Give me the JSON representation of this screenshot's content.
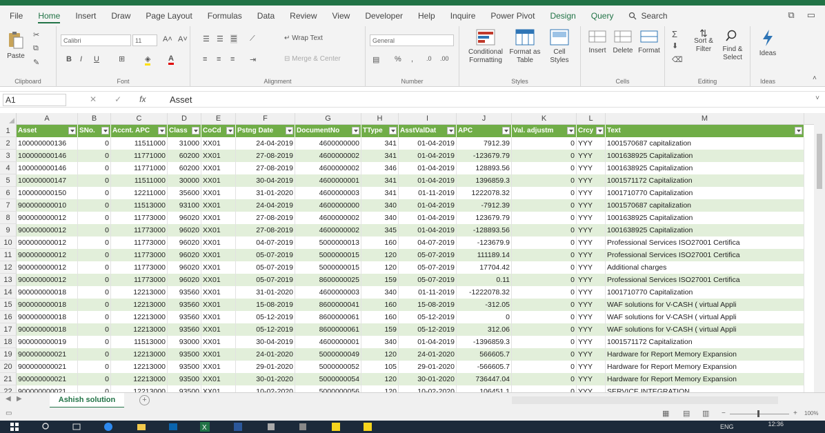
{
  "ribbon": {
    "tabs": [
      "File",
      "Home",
      "Insert",
      "Draw",
      "Page Layout",
      "Formulas",
      "Data",
      "Review",
      "View",
      "Developer",
      "Help",
      "Inquire",
      "Power Pivot",
      "Design",
      "Query"
    ],
    "search_label": "Search",
    "clipboard": {
      "paste": "Paste",
      "label": "Clipboard"
    },
    "font": {
      "name": "Calibri",
      "size": "11",
      "label": "Font"
    },
    "alignment": {
      "wrap": "Wrap Text",
      "merge": "Merge & Center",
      "label": "Alignment"
    },
    "number": {
      "format": "General",
      "label": "Number"
    },
    "styles": {
      "cond1": "Conditional",
      "cond2": "Formatting",
      "fmt1": "Format as",
      "fmt2": "Table",
      "cell1": "Cell",
      "cell2": "Styles",
      "label": "Styles"
    },
    "cells": {
      "insert": "Insert",
      "delete": "Delete",
      "format": "Format",
      "label": "Cells"
    },
    "editing": {
      "sort1": "Sort &",
      "sort2": "Filter",
      "find1": "Find &",
      "find2": "Select",
      "label": "Editing"
    },
    "ideas": {
      "btn": "Ideas",
      "label": "Ideas"
    }
  },
  "formula_bar": {
    "name_box": "A1",
    "formula": "Asset"
  },
  "columns": [
    "A",
    "B",
    "C",
    "D",
    "E",
    "F",
    "G",
    "H",
    "I",
    "J",
    "K",
    "L",
    "M"
  ],
  "header": [
    "Asset",
    "SNo.",
    "Accnt. APC",
    "Class",
    "CoCd",
    "Pstng Date",
    "DocumentNo",
    "TType",
    "AsstValDat",
    "APC",
    "Val. adjustm",
    "Crcy",
    "Text"
  ],
  "rows": [
    [
      "2",
      "100000000136",
      "0",
      "11511000",
      "31000",
      "XX01",
      "24-04-2019",
      "4600000000",
      "341",
      "01-04-2019",
      "7912.39",
      "0",
      "YYY",
      "1001570687 capitalization"
    ],
    [
      "3",
      "100000000146",
      "0",
      "11771000",
      "60200",
      "XX01",
      "27-08-2019",
      "4600000002",
      "341",
      "01-04-2019",
      "-123679.79",
      "0",
      "YYY",
      "1001638925 Capitalization"
    ],
    [
      "4",
      "100000000146",
      "0",
      "11771000",
      "60200",
      "XX01",
      "27-08-2019",
      "4600000002",
      "346",
      "01-04-2019",
      "128893.56",
      "0",
      "YYY",
      "1001638925 Capitalization"
    ],
    [
      "5",
      "100000000147",
      "0",
      "11511000",
      "30000",
      "XX01",
      "30-04-2019",
      "4600000001",
      "341",
      "01-04-2019",
      "1396859.3",
      "0",
      "YYY",
      "1001571172 Capitalization"
    ],
    [
      "6",
      "100000000150",
      "0",
      "12211000",
      "35600",
      "XX01",
      "31-01-2020",
      "4600000003",
      "341",
      "01-11-2019",
      "1222078.32",
      "0",
      "YYY",
      "1001710770 Capitalization"
    ],
    [
      "7",
      "900000000010",
      "0",
      "11513000",
      "93100",
      "XX01",
      "24-04-2019",
      "4600000000",
      "340",
      "01-04-2019",
      "-7912.39",
      "0",
      "YYY",
      "1001570687 capitalization"
    ],
    [
      "8",
      "900000000012",
      "0",
      "11773000",
      "96020",
      "XX01",
      "27-08-2019",
      "4600000002",
      "340",
      "01-04-2019",
      "123679.79",
      "0",
      "YYY",
      "1001638925 Capitalization"
    ],
    [
      "9",
      "900000000012",
      "0",
      "11773000",
      "96020",
      "XX01",
      "27-08-2019",
      "4600000002",
      "345",
      "01-04-2019",
      "-128893.56",
      "0",
      "YYY",
      "1001638925 Capitalization"
    ],
    [
      "10",
      "900000000012",
      "0",
      "11773000",
      "96020",
      "XX01",
      "04-07-2019",
      "5000000013",
      "160",
      "04-07-2019",
      "-123679.9",
      "0",
      "YYY",
      "Professional Services ISO27001 Certifica"
    ],
    [
      "11",
      "900000000012",
      "0",
      "11773000",
      "96020",
      "XX01",
      "05-07-2019",
      "5000000015",
      "120",
      "05-07-2019",
      "111189.14",
      "0",
      "YYY",
      "Professional Services ISO27001 Certifica"
    ],
    [
      "12",
      "900000000012",
      "0",
      "11773000",
      "96020",
      "XX01",
      "05-07-2019",
      "5000000015",
      "120",
      "05-07-2019",
      "17704.42",
      "0",
      "YYY",
      "Additional charges"
    ],
    [
      "13",
      "900000000012",
      "0",
      "11773000",
      "96020",
      "XX01",
      "05-07-2019",
      "8600000025",
      "159",
      "05-07-2019",
      "0.11",
      "0",
      "YYY",
      "Professional Services ISO27001 Certifica"
    ],
    [
      "14",
      "900000000018",
      "0",
      "12213000",
      "93560",
      "XX01",
      "31-01-2020",
      "4600000003",
      "340",
      "01-11-2019",
      "-1222078.32",
      "0",
      "YYY",
      "1001710770 Capitalization"
    ],
    [
      "15",
      "900000000018",
      "0",
      "12213000",
      "93560",
      "XX01",
      "15-08-2019",
      "8600000041",
      "160",
      "15-08-2019",
      "-312.05",
      "0",
      "YYY",
      "WAF solutions for V-CASH ( virtual Appli"
    ],
    [
      "16",
      "900000000018",
      "0",
      "12213000",
      "93560",
      "XX01",
      "05-12-2019",
      "8600000061",
      "160",
      "05-12-2019",
      "0",
      "0",
      "YYY",
      "WAF solutions for V-CASH ( virtual Appli"
    ],
    [
      "17",
      "900000000018",
      "0",
      "12213000",
      "93560",
      "XX01",
      "05-12-2019",
      "8600000061",
      "159",
      "05-12-2019",
      "312.06",
      "0",
      "YYY",
      "WAF solutions for V-CASH ( virtual Appli"
    ],
    [
      "18",
      "900000000019",
      "0",
      "11513000",
      "93000",
      "XX01",
      "30-04-2019",
      "4600000001",
      "340",
      "01-04-2019",
      "-1396859.3",
      "0",
      "YYY",
      "1001571172 Capitalization"
    ],
    [
      "19",
      "900000000021",
      "0",
      "12213000",
      "93500",
      "XX01",
      "24-01-2020",
      "5000000049",
      "120",
      "24-01-2020",
      "566605.7",
      "0",
      "YYY",
      "Hardware for Report Memory Expansion"
    ],
    [
      "20",
      "900000000021",
      "0",
      "12213000",
      "93500",
      "XX01",
      "29-01-2020",
      "5000000052",
      "105",
      "29-01-2020",
      "-566605.7",
      "0",
      "YYY",
      "Hardware for Report Memory Expansion"
    ],
    [
      "21",
      "900000000021",
      "0",
      "12213000",
      "93500",
      "XX01",
      "30-01-2020",
      "5000000054",
      "120",
      "30-01-2020",
      "736447.04",
      "0",
      "YYY",
      "Hardware for Report Memory Expansion"
    ],
    [
      "22",
      "900000000021",
      "0",
      "12213000",
      "93500",
      "XX01",
      "10-02-2020",
      "5000000056",
      "120",
      "10-02-2020",
      "106451.1",
      "0",
      "YYY",
      "SERVICE INTEGRATION"
    ]
  ],
  "sheet_tab": "Ashish solution",
  "status": {
    "zoom": "100%"
  },
  "taskbar": {
    "lang": "ENG",
    "time": "12:36"
  }
}
